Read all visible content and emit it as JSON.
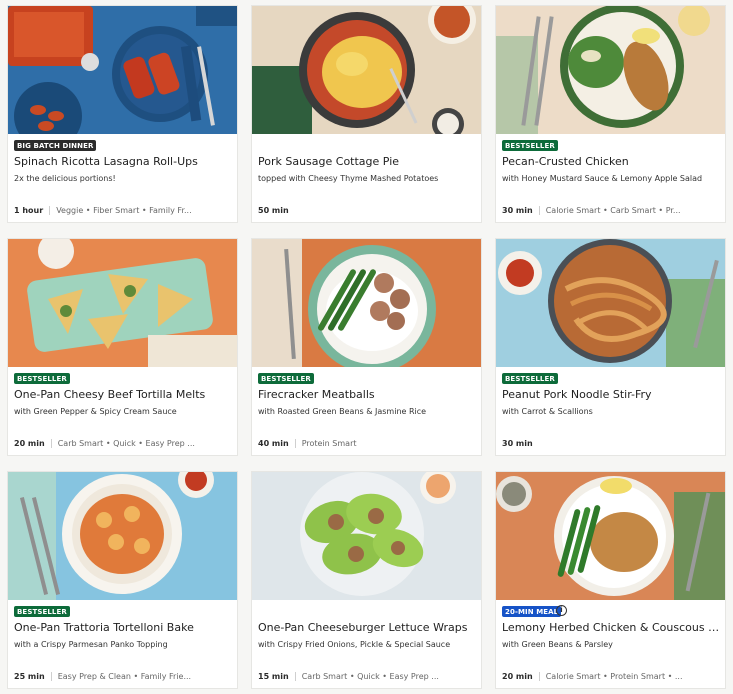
{
  "recipes": [
    {
      "badge": "BIG BATCH DINNER",
      "title": "Spinach Ricotta Lasagna Roll-Ups",
      "subtitle": "2x the delicious portions!",
      "time": "1 hour",
      "tags": "Veggie • Fiber Smart • Family Fr..."
    },
    {
      "badge": "",
      "title": "Pork Sausage Cottage Pie",
      "subtitle": "topped with Cheesy Thyme Mashed Potatoes",
      "time": "50 min",
      "tags": ""
    },
    {
      "badge": "BESTSELLER",
      "title": "Pecan-Crusted Chicken",
      "subtitle": "with Honey Mustard Sauce & Lemony Apple Salad",
      "time": "30 min",
      "tags": "Calorie Smart • Carb Smart • Pr..."
    },
    {
      "badge": "BESTSELLER",
      "title": "One-Pan Cheesy Beef Tortilla Melts",
      "subtitle": "with Green Pepper & Spicy Cream Sauce",
      "time": "20 min",
      "tags": "Carb Smart • Quick • Easy Prep ..."
    },
    {
      "badge": "BESTSELLER",
      "title": "Firecracker Meatballs",
      "subtitle": "with Roasted Green Beans & Jasmine Rice",
      "time": "40 min",
      "tags": "Protein Smart"
    },
    {
      "badge": "BESTSELLER",
      "title": "Peanut Pork Noodle Stir-Fry",
      "subtitle": "with Carrot & Scallions",
      "time": "30 min",
      "tags": ""
    },
    {
      "badge": "BESTSELLER",
      "title": "One-Pan Trattoria Tortelloni Bake",
      "subtitle": "with a Crispy Parmesan Panko Topping",
      "time": "25 min",
      "tags": "Easy Prep & Clean • Family Frie..."
    },
    {
      "badge": "",
      "title": "One-Pan Cheeseburger Lettuce Wraps",
      "subtitle": "with Crispy Fried Onions, Pickle & Special Sauce",
      "time": "15 min",
      "tags": "Carb Smart • Quick • Easy Prep ..."
    },
    {
      "badge": "20-MIN MEAL",
      "title": "Lemony Herbed Chicken & Couscous Ski...",
      "subtitle": "with Green Beans & Parsley",
      "time": "20 min",
      "tags": "Calorie Smart • Protein Smart • ..."
    }
  ],
  "colors": {
    "bestseller": "#0d6b3a",
    "big_batch": "#2b2b2b",
    "twenty_min": "#1653c7"
  },
  "icons": {
    "info": "info-icon"
  }
}
